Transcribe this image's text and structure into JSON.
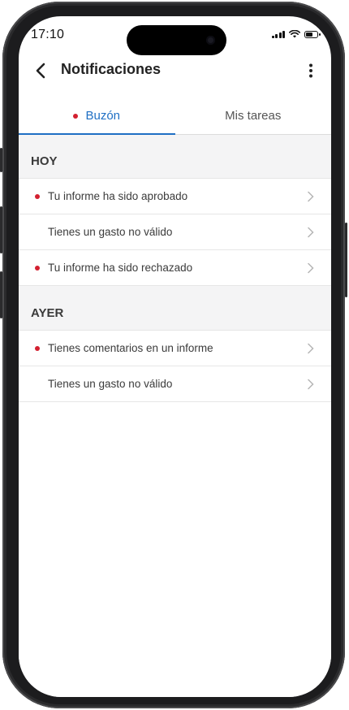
{
  "status_bar": {
    "time": "17:10"
  },
  "header": {
    "title": "Notificaciones",
    "back_icon": "chevron-left-icon",
    "menu_icon": "more-vertical-icon"
  },
  "tabs": [
    {
      "label": "Buzón",
      "active": true,
      "has_unread_dot": true
    },
    {
      "label": "Mis tareas",
      "active": false,
      "has_unread_dot": false
    }
  ],
  "sections": [
    {
      "title": "HOY",
      "items": [
        {
          "label": "Tu informe ha sido aprobado",
          "unread": true
        },
        {
          "label": "Tienes un gasto no válido",
          "unread": false
        },
        {
          "label": "Tu informe ha sido rechazado",
          "unread": true
        }
      ]
    },
    {
      "title": "AYER",
      "items": [
        {
          "label": "Tienes comentarios en un informe",
          "unread": true
        },
        {
          "label": "Tienes un gasto no válido",
          "unread": false
        }
      ]
    }
  ],
  "colors": {
    "accent": "#1f6fc4",
    "unread_dot": "#d32030",
    "section_bg": "#f4f4f5"
  }
}
